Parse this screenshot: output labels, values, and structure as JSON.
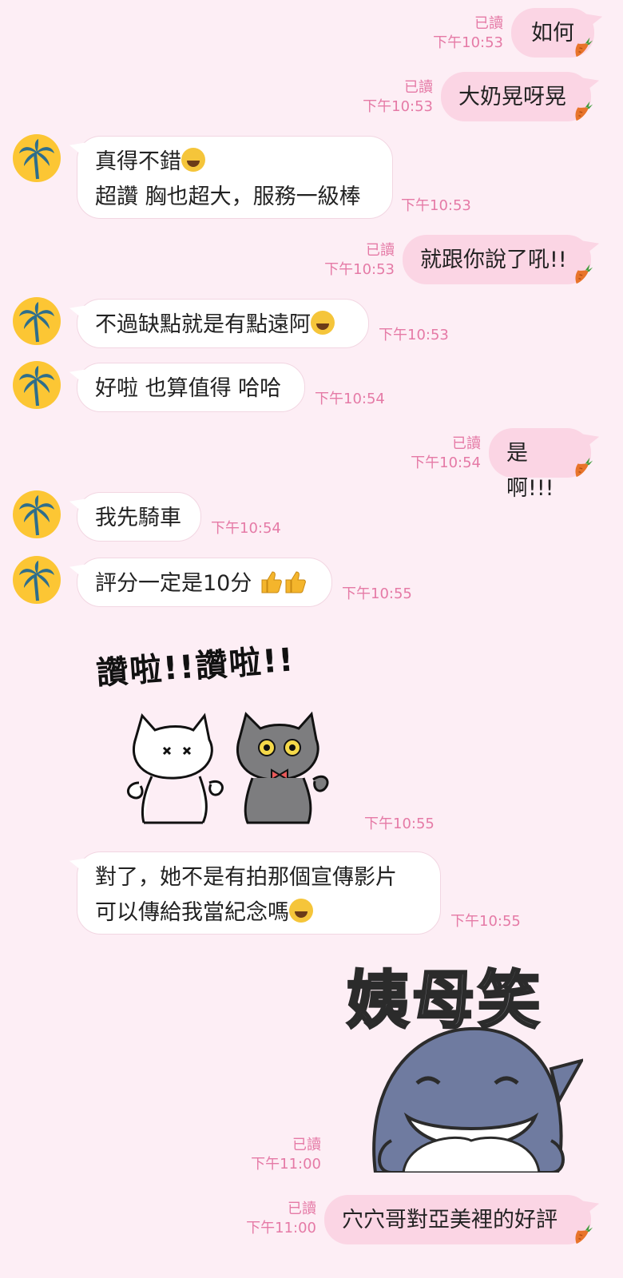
{
  "messages": {
    "m1": {
      "text": "如何",
      "read": "已讀",
      "time": "下午10:53"
    },
    "m2": {
      "text": "大奶晃呀晃",
      "read": "已讀",
      "time": "下午10:53"
    },
    "m3": {
      "line1": "真得不錯",
      "line2": "超讚 胸也超大，服務一級棒",
      "time": "下午10:53",
      "emoji": "tears-of-joy-emoji"
    },
    "m4": {
      "text": "就跟你說了吼!!",
      "read": "已讀",
      "time": "下午10:53"
    },
    "m5": {
      "text": "不過缺點就是有點遠阿",
      "time": "下午10:53",
      "emoji": "rolling-laughing-emoji"
    },
    "m6": {
      "text": "好啦 也算值得 哈哈",
      "time": "下午10:54"
    },
    "m7": {
      "text": "是啊!!!",
      "read": "已讀",
      "time": "下午10:54"
    },
    "m8": {
      "text": "我先騎車",
      "time": "下午10:54"
    },
    "m9": {
      "text": "評分一定是10分",
      "time": "下午10:55",
      "emoji": "thumbs-up-emoji"
    },
    "sticker1": {
      "caption": "讚啦!!讚啦!!",
      "time": "下午10:55"
    },
    "m10": {
      "line1": "對了，她不是有拍那個宣傳影片",
      "line2": "可以傳給我當紀念嗎",
      "time": "下午10:55",
      "emoji": "tears-of-joy-emoji"
    },
    "sticker2": {
      "caption": "姨母笑",
      "read": "已讀",
      "time": "下午11:00"
    },
    "m11": {
      "text": "穴穴哥對亞美裡的好評",
      "read": "已讀",
      "time": "下午11:00"
    }
  },
  "colors": {
    "background": "#fdeef5",
    "outgoing": "#fbd5e4",
    "incoming": "#ffffff",
    "meta": "#e57aa6",
    "avatar": "#fcc634"
  },
  "icons": {
    "avatar": "palm-tree-icon",
    "read_marker": "carrot-icon"
  }
}
